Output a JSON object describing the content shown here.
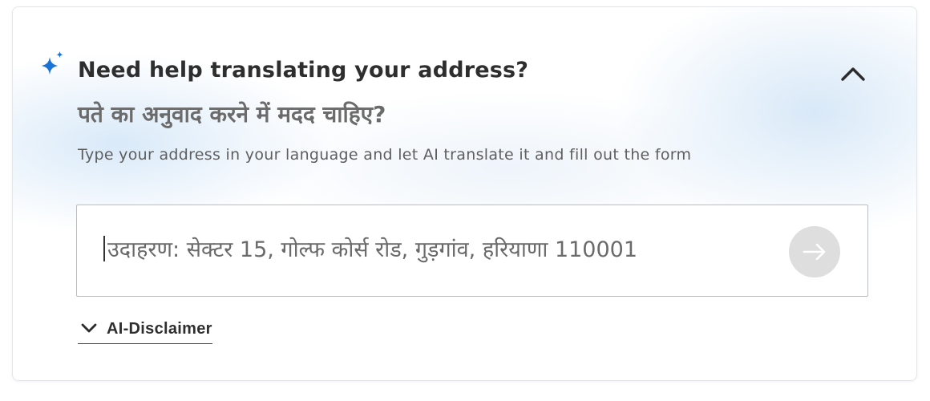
{
  "card": {
    "title": "Need help translating your address?",
    "subtitle_hindi": "पते का अनुवाद करने में मदद चाहिए?",
    "description": "Type your address in your language and let AI translate it and fill out the form",
    "sparkle_icon": "sparkle-icon",
    "collapse_icon": "chevron-up-icon"
  },
  "address_input": {
    "value": "",
    "placeholder": "उदाहरण: सेक्टर 15, गोल्फ कोर्स रोड, गुड़गांव, हरियाणा 110001",
    "submit_icon": "arrow-right-icon",
    "submit_enabled": false
  },
  "disclaimer": {
    "label": "AI-Disclaimer",
    "icon": "chevron-down-icon",
    "expanded": false
  },
  "colors": {
    "sparkle": "#1a73d9",
    "title_text": "#2e2e2e",
    "secondary_text": "#6b6b6b",
    "input_border": "#b9bdc4",
    "submit_disabled_bg": "#dedede",
    "card_glow": "#d7e8f8"
  }
}
